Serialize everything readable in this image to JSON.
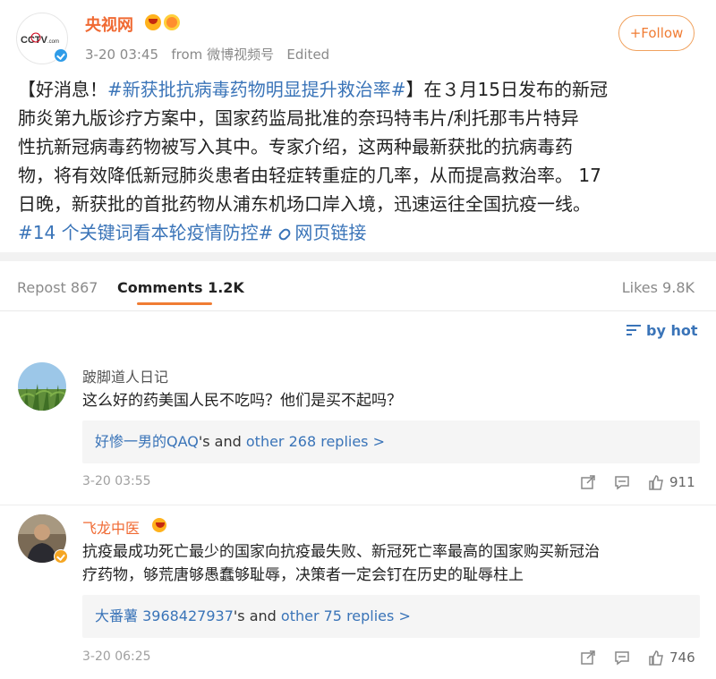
{
  "post": {
    "author": "央视网",
    "avatar_logo": "CCTV.com",
    "badge_icons": [
      "vip-crown-icon",
      "cat-emoji-icon"
    ],
    "timestamp": "3-20 03:45",
    "from_label": "from",
    "source": "微博视频号",
    "edited": "Edited",
    "follow_label": "+Follow",
    "lines": [
      {
        "prefix": "【好消息！",
        "tag": "#新获批抗病毒药物明显提升救治率#",
        "suffix": "】在３月15日发布的新冠"
      },
      {
        "text": "肺炎第九版诊疗方案中，国家药监局批准的奈玛特韦片/利托那韦片特异"
      },
      {
        "text": "性抗新冠病毒药物被写入其中。专家介绍，这两种最新获批的抗病毒药"
      },
      {
        "text": "物，将有效降低新冠肺炎患者由轻症转重症的几率，从而提高救治率。 17"
      },
      {
        "text": "日晚，新获批的首批药物从浦东机场口岸入境，迅速运往全国抗疫一线。"
      }
    ],
    "topic_tag": "#14 个关键词看本轮疫情防控#",
    "web_link": "网页链接"
  },
  "tabs": {
    "repost": "Repost 867",
    "comments": "Comments 1.2K",
    "likes": "Likes 9.8K"
  },
  "sort_label": "by hot",
  "comments": [
    {
      "name": "跛脚道人日记",
      "lines": [
        "这么好的药美国人民不吃吗？他们是买不起吗？"
      ],
      "reply_user": "好惨一男的QAQ",
      "reply_mid": "'s and ",
      "reply_more": "other 268 replies >",
      "time": "3-20 03:55",
      "likes": "911"
    },
    {
      "name": "飞龙中医",
      "lines": [
        "抗疫最成功死亡最少的国家向抗疫最失败、新冠死亡率最高的国家购买新冠治",
        "疗药物，够荒唐够愚蠢够耻辱，决策者一定会钉在历史的耻辱柱上"
      ],
      "reply_user": "大番薯 3968427937",
      "reply_mid": "'s and ",
      "reply_more": "other 75 replies >",
      "time": "3-20 06:25",
      "likes": "746"
    }
  ],
  "colors": {
    "accent_orange": "#f07c33",
    "link_blue": "#3a74b8",
    "verified_blue": "#2f9ce8",
    "verified_gold": "#f5a623"
  }
}
